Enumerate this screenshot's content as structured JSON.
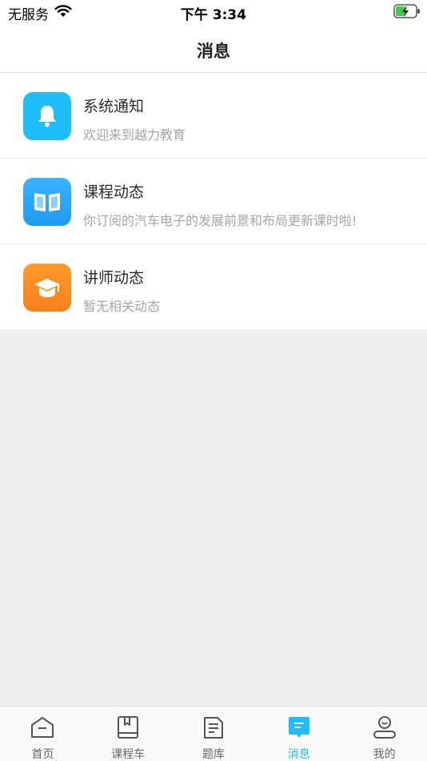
{
  "status_bar": {
    "carrier": "无服务",
    "time": "下午 3:34"
  },
  "nav": {
    "title": "消息"
  },
  "messages": [
    {
      "title": "系统通知",
      "subtitle": "欢迎来到越力教育",
      "icon": "bell-icon",
      "color": "#1fbdf9"
    },
    {
      "title": "课程动态",
      "subtitle": "你订阅的汽车电子的发展前景和布局更新课时啦!",
      "icon": "book-icon",
      "color": "#2ea8fb"
    },
    {
      "title": "讲师动态",
      "subtitle": "暂无相关动态",
      "icon": "graduation-cap-icon",
      "color": "#f98a22"
    }
  ],
  "tabs": [
    {
      "label": "首页",
      "icon": "home-icon",
      "active": false
    },
    {
      "label": "课程车",
      "icon": "course-book-icon",
      "active": false
    },
    {
      "label": "题库",
      "icon": "question-bank-icon",
      "active": false
    },
    {
      "label": "消息",
      "icon": "message-icon",
      "active": true
    },
    {
      "label": "我的",
      "icon": "profile-icon",
      "active": false
    }
  ],
  "colors": {
    "accent": "#1fbdf9",
    "background": "#efefef"
  }
}
